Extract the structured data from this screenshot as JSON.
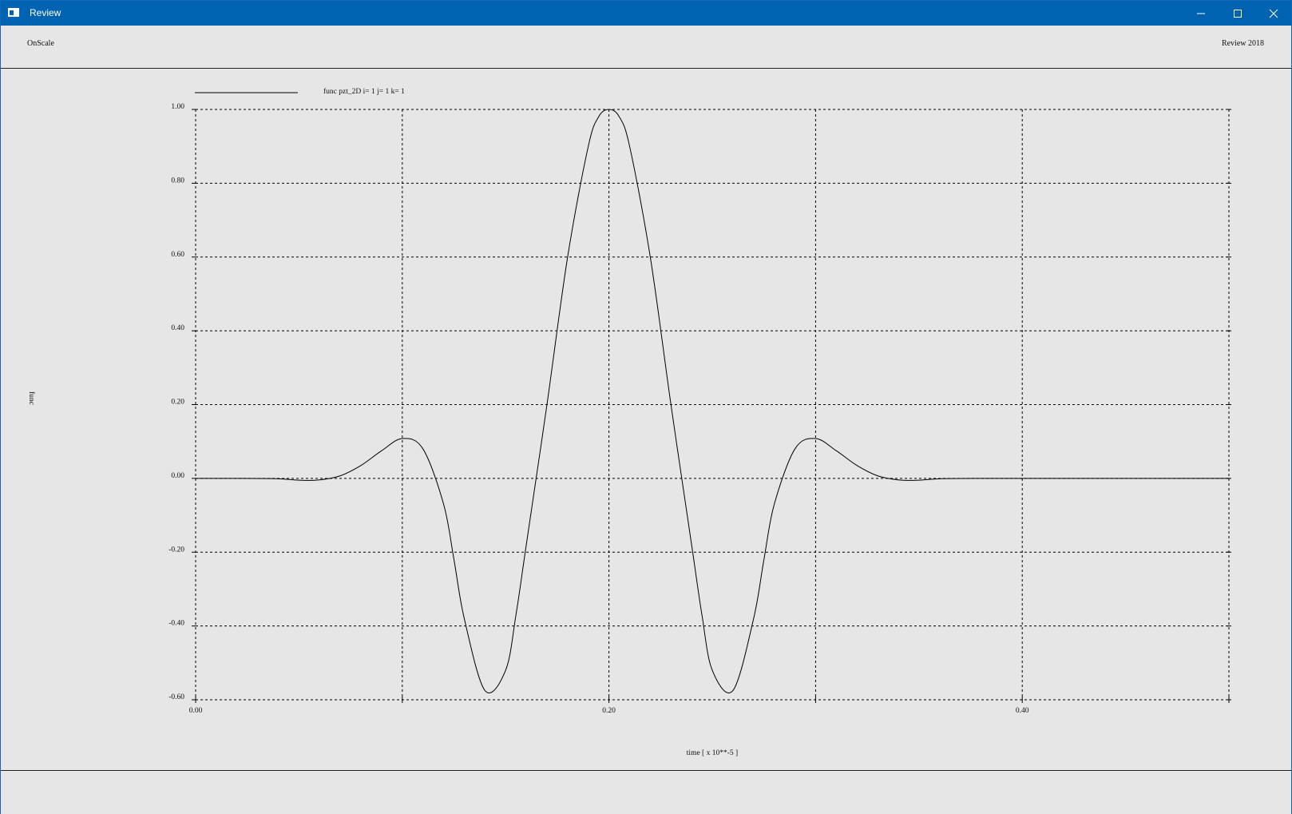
{
  "window": {
    "title": "Review",
    "controls": {
      "minimize_icon": "minimize-icon",
      "maximize_icon": "maximize-icon",
      "close_icon": "close-icon"
    },
    "accent_color": "#0063b1"
  },
  "header": {
    "left_label": "OnScale",
    "right_label": "Review 2018"
  },
  "chart_data": {
    "type": "line",
    "xlabel": "time [ x 10**-5 ]",
    "ylabel": "func",
    "xlim": [
      0.0,
      0.5
    ],
    "ylim": [
      -0.6,
      1.0
    ],
    "x_ticks": [
      "0.00",
      "0.20",
      "0.40"
    ],
    "x_tick_values": [
      0.0,
      0.2,
      0.4
    ],
    "x_grid_values": [
      0.0,
      0.1,
      0.2,
      0.3,
      0.4,
      0.5
    ],
    "y_ticks": [
      "1.00",
      "0.80",
      "0.60",
      "0.40",
      "0.20",
      "0.00",
      "-0.20",
      "-0.40",
      "-0.60"
    ],
    "y_tick_values": [
      1.0,
      0.8,
      0.6,
      0.4,
      0.2,
      0.0,
      -0.2,
      -0.4,
      -0.6
    ],
    "grid": true,
    "grid_style": "dashed",
    "legend_position": "top-left",
    "series": [
      {
        "name": "func pzt_2D i= 1 j= 1 k= 1",
        "color": "#000000",
        "x": [
          0.0,
          0.02,
          0.04,
          0.05,
          0.06,
          0.07,
          0.08,
          0.09,
          0.1,
          0.11,
          0.12,
          0.125,
          0.13,
          0.14,
          0.15,
          0.155,
          0.16,
          0.17,
          0.18,
          0.19,
          0.195,
          0.2,
          0.205,
          0.21,
          0.22,
          0.23,
          0.24,
          0.245,
          0.25,
          0.26,
          0.27,
          0.275,
          0.28,
          0.29,
          0.3,
          0.31,
          0.32,
          0.33,
          0.34,
          0.35,
          0.36,
          0.38,
          0.4,
          0.45,
          0.5
        ],
        "values": [
          0.0,
          0.0,
          -0.001,
          -0.005,
          -0.004,
          0.007,
          0.035,
          0.075,
          0.108,
          0.08,
          -0.07,
          -0.22,
          -0.38,
          -0.575,
          -0.52,
          -0.37,
          -0.18,
          0.2,
          0.6,
          0.9,
          0.98,
          1.0,
          0.98,
          0.9,
          0.6,
          0.2,
          -0.18,
          -0.37,
          -0.52,
          -0.575,
          -0.38,
          -0.22,
          -0.07,
          0.08,
          0.108,
          0.075,
          0.035,
          0.007,
          -0.004,
          -0.005,
          -0.001,
          0.0,
          0.0,
          0.0,
          0.0
        ]
      }
    ]
  }
}
